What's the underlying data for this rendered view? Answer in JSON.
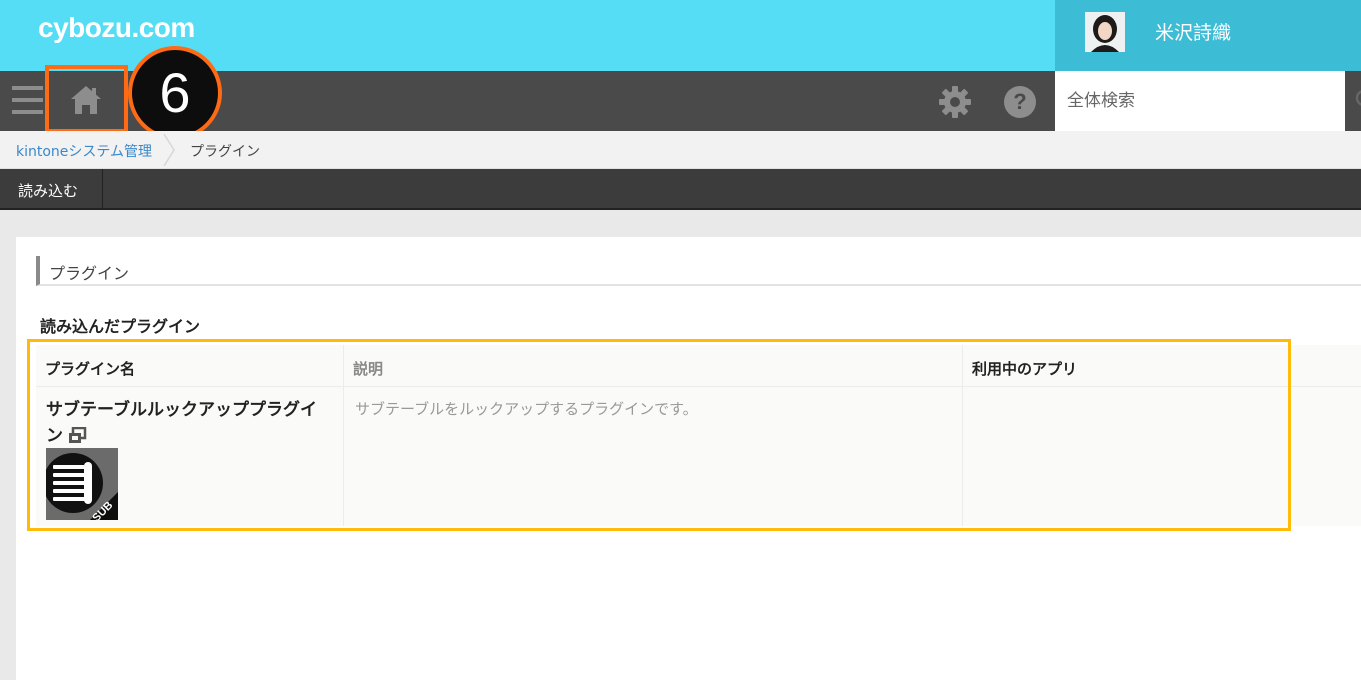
{
  "header": {
    "logo": "cybozu.com",
    "user_name": "米沢詩織"
  },
  "nav": {
    "search_placeholder": "全体検索",
    "step_number": "6",
    "help_glyph": "?"
  },
  "breadcrumb": {
    "parent": "kintoneシステム管理",
    "current": "プラグイン"
  },
  "toolbar": {
    "import_label": "読み込む"
  },
  "page": {
    "section_title": "プラグイン",
    "sub_heading": "読み込んだプラグイン"
  },
  "table": {
    "headers": [
      "プラグイン名",
      "説明",
      "利用中のアプリ"
    ],
    "rows": [
      {
        "name": "サブテーブルルックアッププラグイン",
        "description": "サブテーブルをルックアップするプラグインです。",
        "apps": "",
        "icon_label": "SUB"
      }
    ]
  },
  "colors": {
    "topbar": "#55ddf6",
    "navbar": "#4a4a4a",
    "highlight_orange": "#ff6a14",
    "table_highlight": "#ffba0a",
    "link": "#3b88c9"
  }
}
